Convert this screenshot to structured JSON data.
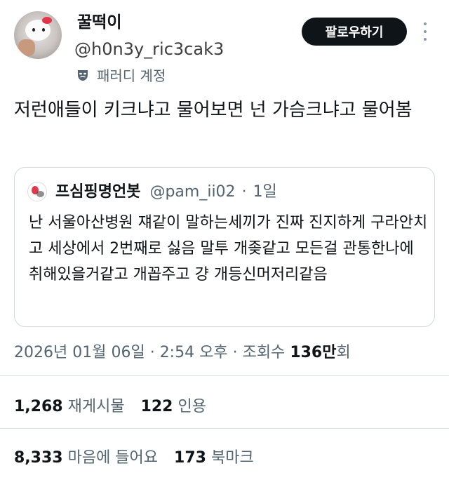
{
  "author": {
    "display_name": "꿀떡이",
    "handle": "@h0n3y_ric3cak3",
    "parody_label": "패러디 계정"
  },
  "follow_label": "팔로우하기",
  "tweet_text": "저런애들이 키크냐고 물어보면 넌 가슴크냐고 물어봄",
  "quote": {
    "name": "프심핑명언봇",
    "handle": "@pam_ii02",
    "separator": "·",
    "time": "1일",
    "text": "난 서울아산병원 쟤같이 말하는세끼가 진짜 진지하게 구라안치고 세상에서 2번째로 싫음 말투 개좆같고 모든걸 관통한나에 취해있을거같고 개꼽주고 걍 개등신머저리같음"
  },
  "meta": {
    "date": "2026년 01월 06일",
    "sep1": "·",
    "time": "2:54 오후",
    "sep2": "·",
    "views_label": "조회수",
    "views_num": "136만",
    "views_suffix": "회"
  },
  "stats": {
    "reposts_count": "1,268",
    "reposts_label": "재게시물",
    "quotes_count": "122",
    "quotes_label": "인용",
    "likes_count": "8,333",
    "likes_label": "마음에 들어요",
    "bookmarks_count": "173",
    "bookmarks_label": "북마크"
  },
  "colors": {
    "text": "#0f1419",
    "secondary": "#536471",
    "border": "#cfd9de",
    "button_bg": "#0f1419"
  },
  "icons": {
    "parody": "theater-mask-icon",
    "more": "more-vertical-icon"
  }
}
